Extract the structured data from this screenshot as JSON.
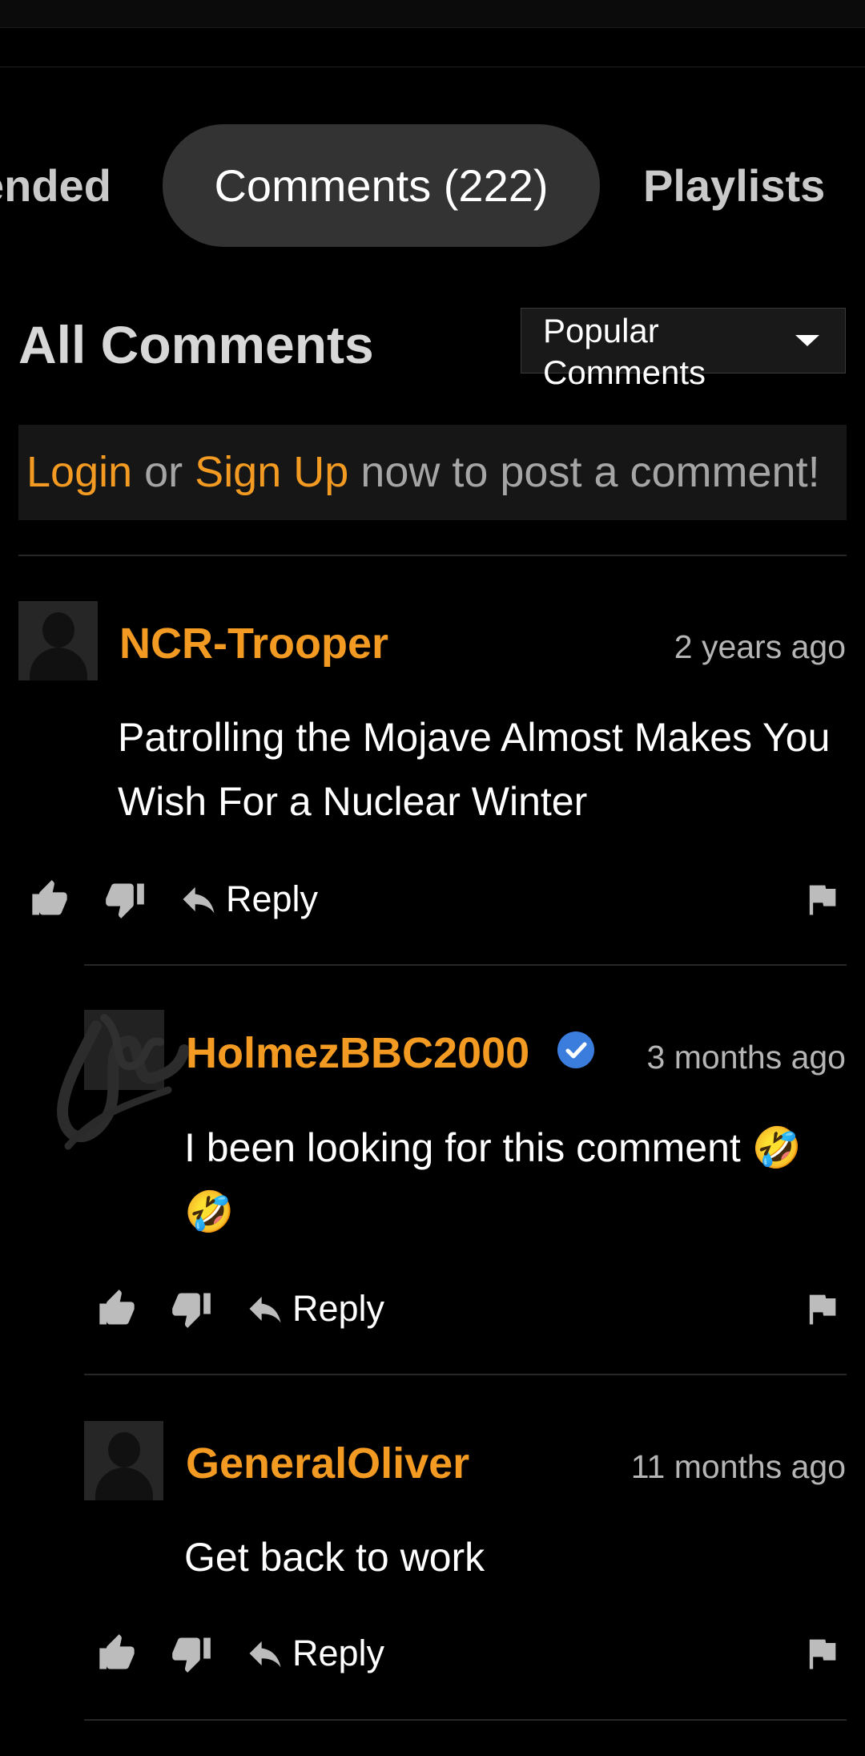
{
  "tabs": [
    {
      "label": "ended"
    },
    {
      "label": "Comments (222)"
    },
    {
      "label": "Playlists"
    }
  ],
  "comments_section": {
    "title": "All Comments",
    "sort": {
      "selected": "Popular Comments"
    },
    "login_banner": {
      "login": "Login",
      "or": " or ",
      "signup": "Sign Up",
      "rest": " now to post a comment!"
    }
  },
  "comments": [
    {
      "username": "NCR-Trooper",
      "time": "2 years ago",
      "text": "Patrolling the Mojave Almost Makes You Wish For a Nuclear Winter",
      "reply_label": "Reply",
      "avatar": "default-avatar"
    },
    {
      "username": "HolmezBBC2000",
      "verified": true,
      "time": "3 months ago",
      "text": "I been looking for this comment 🤣🤣",
      "reply_label": "Reply",
      "avatar": "scribbled-avatar"
    },
    {
      "username": "GeneralOliver",
      "time": "11 months ago",
      "text": "Get back to work",
      "reply_label": "Reply",
      "avatar": "default-avatar"
    }
  ],
  "icons": {
    "like": "thumbs-up-icon",
    "dislike": "thumbs-down-icon",
    "reply": "reply-arrow-icon",
    "report": "flag-icon",
    "sort": "caret-down-icon",
    "verified": "verified-check-icon"
  },
  "colors": {
    "background": "#000000",
    "accent": "#f29a21",
    "active_tab": "#333333",
    "banner": "#161616",
    "verified": "#3b7ddd",
    "icon": "#bcbcbc"
  }
}
